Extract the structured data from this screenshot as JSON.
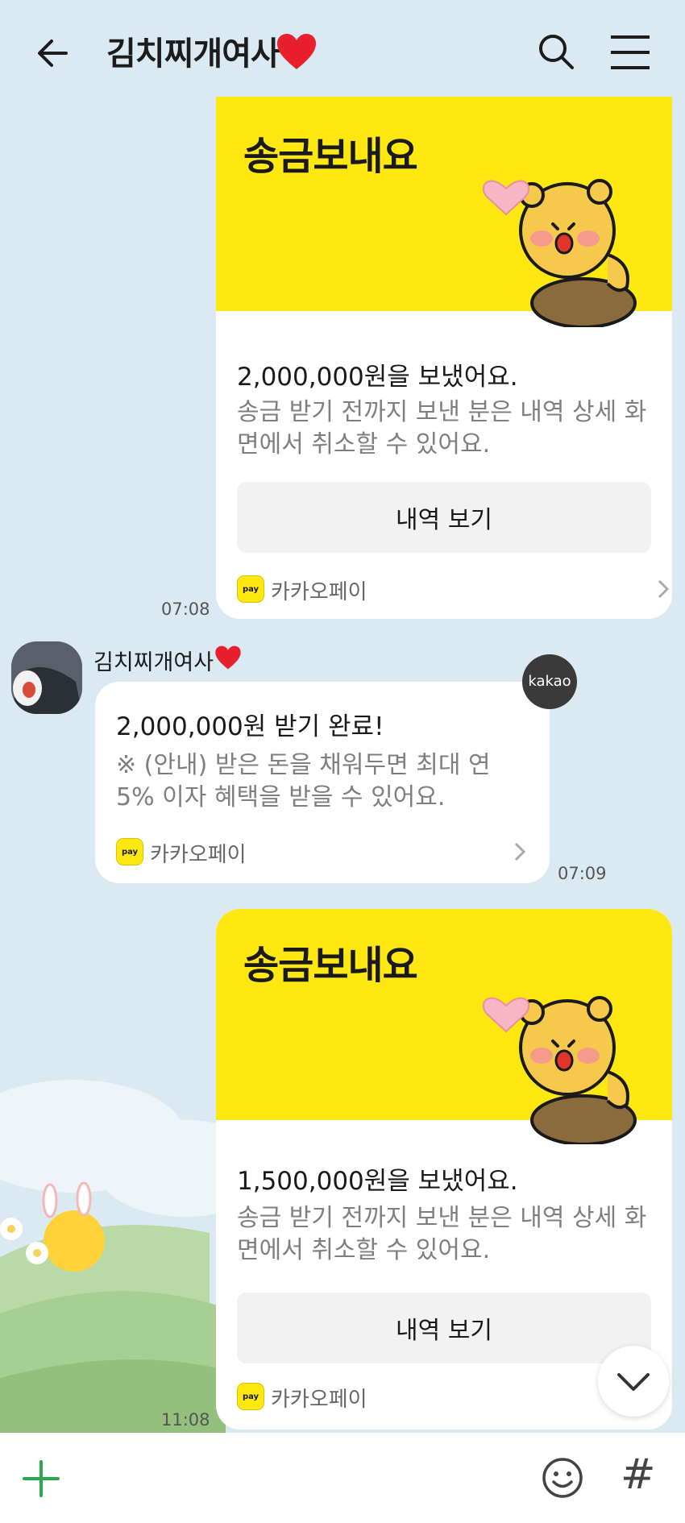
{
  "header": {
    "title": "김치찌개여사",
    "back_icon": "arrow-left-icon",
    "search_icon": "search-icon",
    "menu_icon": "hamburger-menu-icon"
  },
  "colors": {
    "background": "#dbeaf2",
    "kakao_yellow": "#ffe812",
    "card_white": "#ffffff",
    "heart_red": "#e8202e"
  },
  "messages": [
    {
      "type": "sent_transfer",
      "banner_title": "송금보내요",
      "amount_text": "2,000,000원을 보냈어요.",
      "description": "송금 받기 전까지 보낸 분은 내역 상세 화면에서 취소할 수 있어요.",
      "button_label": "내역 보기",
      "pay_label": "카카오페이",
      "time": "07:08"
    },
    {
      "type": "received_notice",
      "sender": "김치찌개여사",
      "badge": "kakao",
      "amount_text": "2,000,000원 받기 완료!",
      "description": "※ (안내) 받은 돈을 채워두면 최대 연 5% 이자 혜택을 받을 수 있어요.",
      "pay_label": "카카오페이",
      "time": "07:09"
    },
    {
      "type": "sent_transfer",
      "banner_title": "송금보내요",
      "amount_text": "1,500,000원을 보냈어요.",
      "description": "송금 받기 전까지 보낸 분은 내역 상세 화면에서 취소할 수 있어요.",
      "button_label": "내역 보기",
      "pay_label": "카카오페이",
      "time": "11:08"
    }
  ],
  "pay_logo_text": "pay",
  "input_bar": {
    "plus_icon": "plus-icon",
    "emoji_icon": "emoji-icon",
    "hash_label": "#"
  },
  "scroll_down_icon": "chevron-down-icon"
}
